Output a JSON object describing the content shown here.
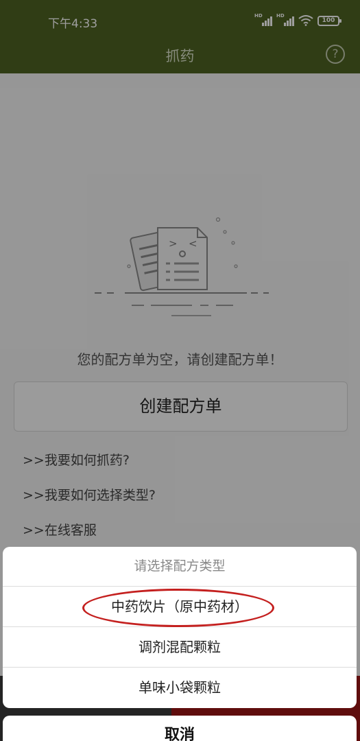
{
  "status_bar": {
    "time": "下午4:33",
    "signal_label": "HD",
    "battery": "100"
  },
  "header": {
    "title": "抓药",
    "help_icon": "?"
  },
  "main": {
    "empty_message": "您的配方单为空，请创建配方单！",
    "create_button": "创建配方单",
    "links": [
      ">>我要如何抓药?",
      ">>我要如何选择类型?",
      ">>在线客服"
    ]
  },
  "action_sheet": {
    "title": "请选择配方类型",
    "options": [
      "中药饮片（原中药材）",
      "调剂混配颗粒",
      "单味小袋颗粒"
    ],
    "cancel": "取消"
  },
  "colors": {
    "header_bg": "#4e6322",
    "highlight_circle": "#c4201f"
  }
}
